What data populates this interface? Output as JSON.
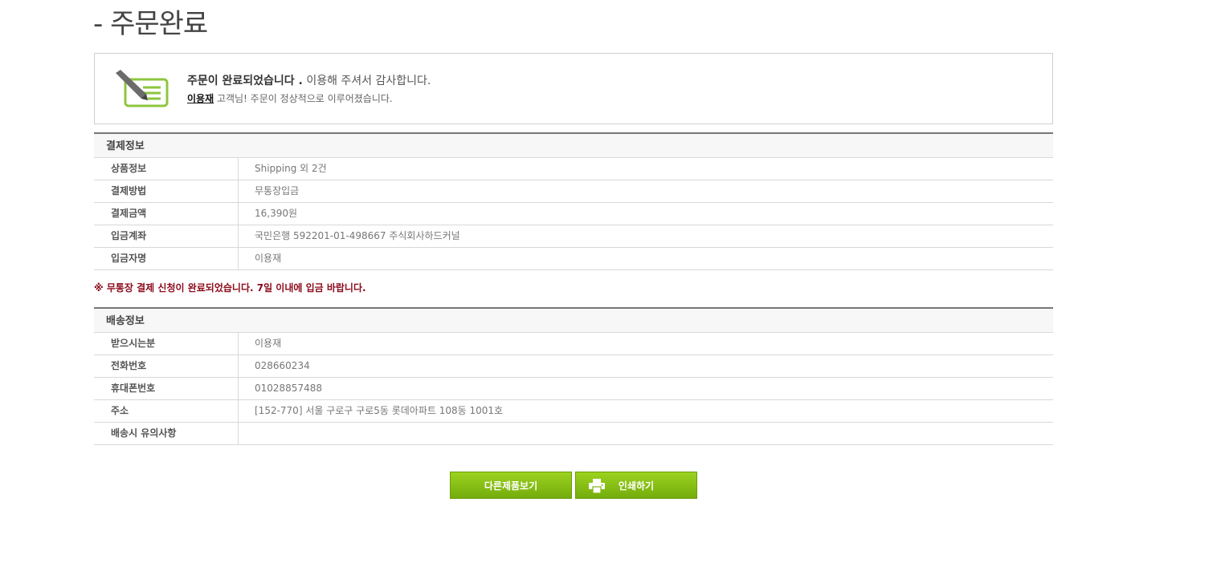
{
  "page": {
    "title": "- 주문완료"
  },
  "notice": {
    "icon": "order-check-icon",
    "line1_bold": "주문이 완료되었습니다 .",
    "line1_rest": " 이용해 주셔서 감사합니다.",
    "customer_name": "이용재",
    "line2_rest": " 고객님! 주문이 정상적으로 이루어졌습니다."
  },
  "payment": {
    "title": "결제정보",
    "rows": [
      {
        "label": "상품정보",
        "value": "Shipping 외 2건"
      },
      {
        "label": "결제방법",
        "value": "무통장입금"
      },
      {
        "label": "결제금액",
        "value": "16,390원"
      },
      {
        "label": "입금계좌",
        "value": "국민은행 592201-01-498667 주식회사하드커널"
      },
      {
        "label": "입금자명",
        "value": "이용재"
      }
    ],
    "warning": "※ 무통장 결제 신청이 완료되었습니다. 7일 이내에 입금 바랍니다."
  },
  "shipping": {
    "title": "배송정보",
    "rows": [
      {
        "label": "받으시는분",
        "value": "이용재"
      },
      {
        "label": "전화번호",
        "value": "028660234"
      },
      {
        "label": "휴대폰번호",
        "value": "01028857488"
      },
      {
        "label": "주소",
        "value": "[152-770] 서울 구로구 구로5동 롯데아파트  108동 1001호"
      },
      {
        "label": "배송시 유의사항",
        "value": ""
      }
    ]
  },
  "buttons": {
    "more_products": "다른제품보기",
    "print": "인쇄하기",
    "print_icon": "printer-icon"
  },
  "colors": {
    "accent_green": "#86bf15",
    "warning_red": "#8b0a1a"
  }
}
